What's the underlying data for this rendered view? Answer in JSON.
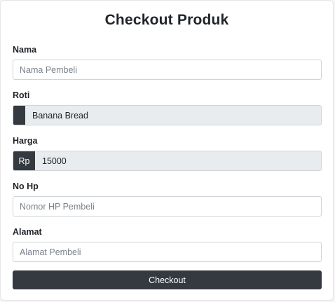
{
  "form": {
    "title": "Checkout Produk",
    "nama": {
      "label": "Nama",
      "placeholder": "Nama Pembeli",
      "value": ""
    },
    "roti": {
      "label": "Roti",
      "value": "Banana Bread"
    },
    "harga": {
      "label": "Harga",
      "prefix": "Rp",
      "value": "15000"
    },
    "nohp": {
      "label": "No Hp",
      "placeholder": "Nomor HP Pembeli",
      "value": ""
    },
    "alamat": {
      "label": "Alamat",
      "placeholder": "Alamat Pembeli",
      "value": ""
    },
    "submit_label": "Checkout"
  },
  "colors": {
    "dark": "#343a40",
    "readonly_bg": "#e9ecef",
    "border": "#ced4da",
    "text": "#212529"
  }
}
